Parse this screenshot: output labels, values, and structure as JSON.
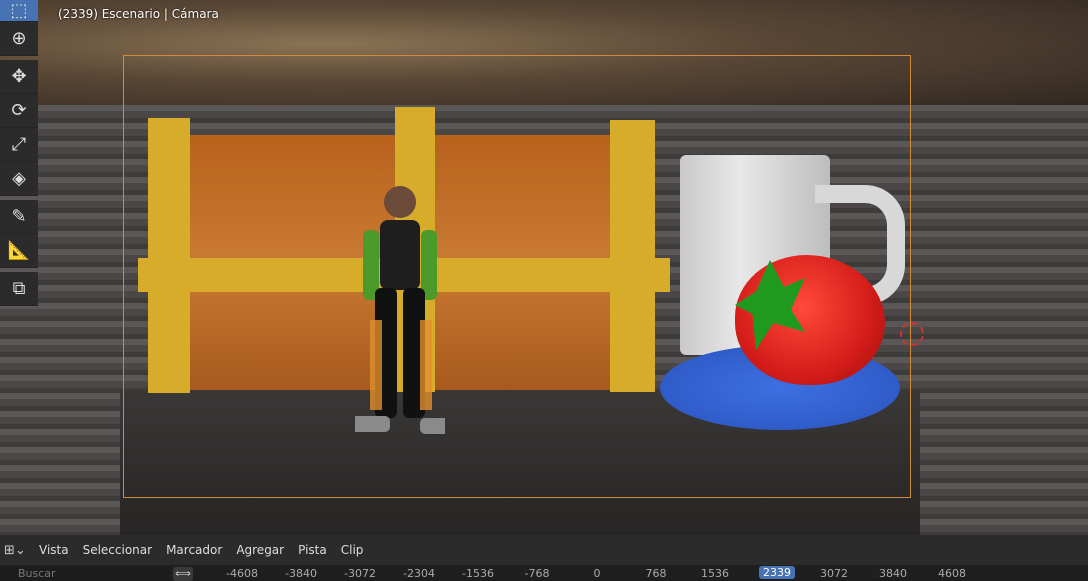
{
  "viewport": {
    "overlay_text": "(2339) Escenario | Cámara"
  },
  "toolbar": {
    "tools": [
      "select-box",
      "cursor",
      "move",
      "rotate",
      "scale",
      "transform",
      "annotate",
      "measure",
      "add-cube"
    ],
    "active": "select-box"
  },
  "timeline": {
    "menu": [
      "Vista",
      "Seleccionar",
      "Marcador",
      "Agregar",
      "Pista",
      "Clip"
    ],
    "search_placeholder": "Buscar",
    "ticks": [
      "-4608",
      "-3840",
      "-3072",
      "-2304",
      "-1536",
      "-768",
      "0",
      "768",
      "1536",
      "2339",
      "3072",
      "3840",
      "4608"
    ],
    "current_frame": "2339"
  },
  "colors": {
    "accent": "#4772b3",
    "camera_frame": "#d08a3a"
  }
}
